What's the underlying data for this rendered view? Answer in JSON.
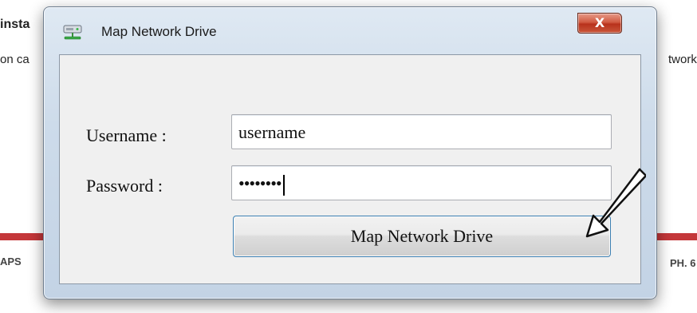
{
  "background": {
    "left_heading": "insta",
    "left_line": "on ca",
    "right_line": "twork",
    "footer_left": "APS",
    "footer_right": "PH. 6"
  },
  "window": {
    "title": "Map Network Drive",
    "close_label": "X",
    "icon": "network-drive-icon"
  },
  "form": {
    "username_label": "Username :",
    "username_value": "username",
    "password_label": "Password :",
    "password_value": "••••••••",
    "submit_label": "Map Network Drive"
  },
  "colors": {
    "close_button": "#c9422a",
    "button_focus_border": "#3c7fb1",
    "background_accent": "#c4373a"
  }
}
